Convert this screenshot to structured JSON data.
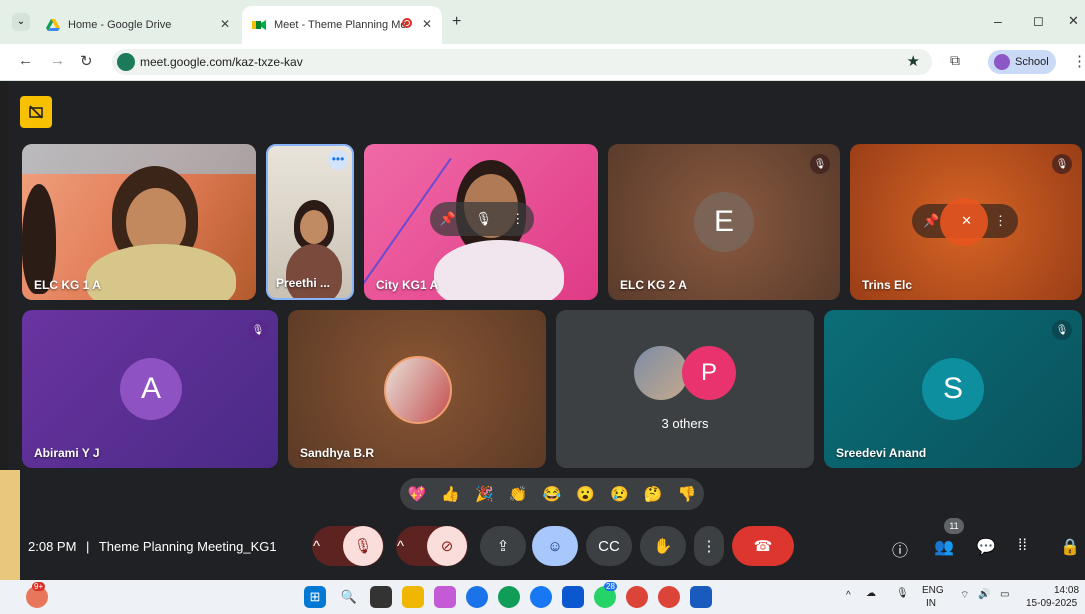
{
  "browser": {
    "tabs": [
      {
        "title": "Home - Google Drive"
      },
      {
        "title": "Meet - Theme Planning Me"
      }
    ],
    "url": "meet.google.com/kaz-txze-kav",
    "profile_label": "School",
    "win_minimize": "–",
    "win_maximize": "◻",
    "win_close": "✕"
  },
  "meet": {
    "tiles_row1": [
      {
        "name": "ELC KG 1 A"
      },
      {
        "name": "Preethi ..."
      },
      {
        "name": "City KG1 A"
      },
      {
        "name": "ELC KG 2 A",
        "initial": "E"
      },
      {
        "name": "Trins Elc"
      }
    ],
    "tiles_row2": [
      {
        "name": "Abirami Y J",
        "initial": "A"
      },
      {
        "name": "Sandhya B.R"
      },
      {
        "name": "3 others",
        "initial": "P"
      },
      {
        "name": "Sreedevi Anand",
        "initial": "S"
      }
    ],
    "emojis": [
      "💖",
      "👍",
      "🎉",
      "👏",
      "😂",
      "😮",
      "😢",
      "🤔",
      "👎"
    ],
    "time": "2:08 PM",
    "separator": "|",
    "meeting_title": "Theme Planning Meeting_KG1",
    "participant_count": "11"
  },
  "taskbar": {
    "badge": "9+",
    "lang": "ENG",
    "region": "IN",
    "clock_time": "14:08",
    "clock_date": "15-09-2025",
    "badge2": "28"
  },
  "colors": {
    "accent_red": "#d93025",
    "meet_bg": "#202124",
    "chrome_green": "#e3efe7"
  }
}
